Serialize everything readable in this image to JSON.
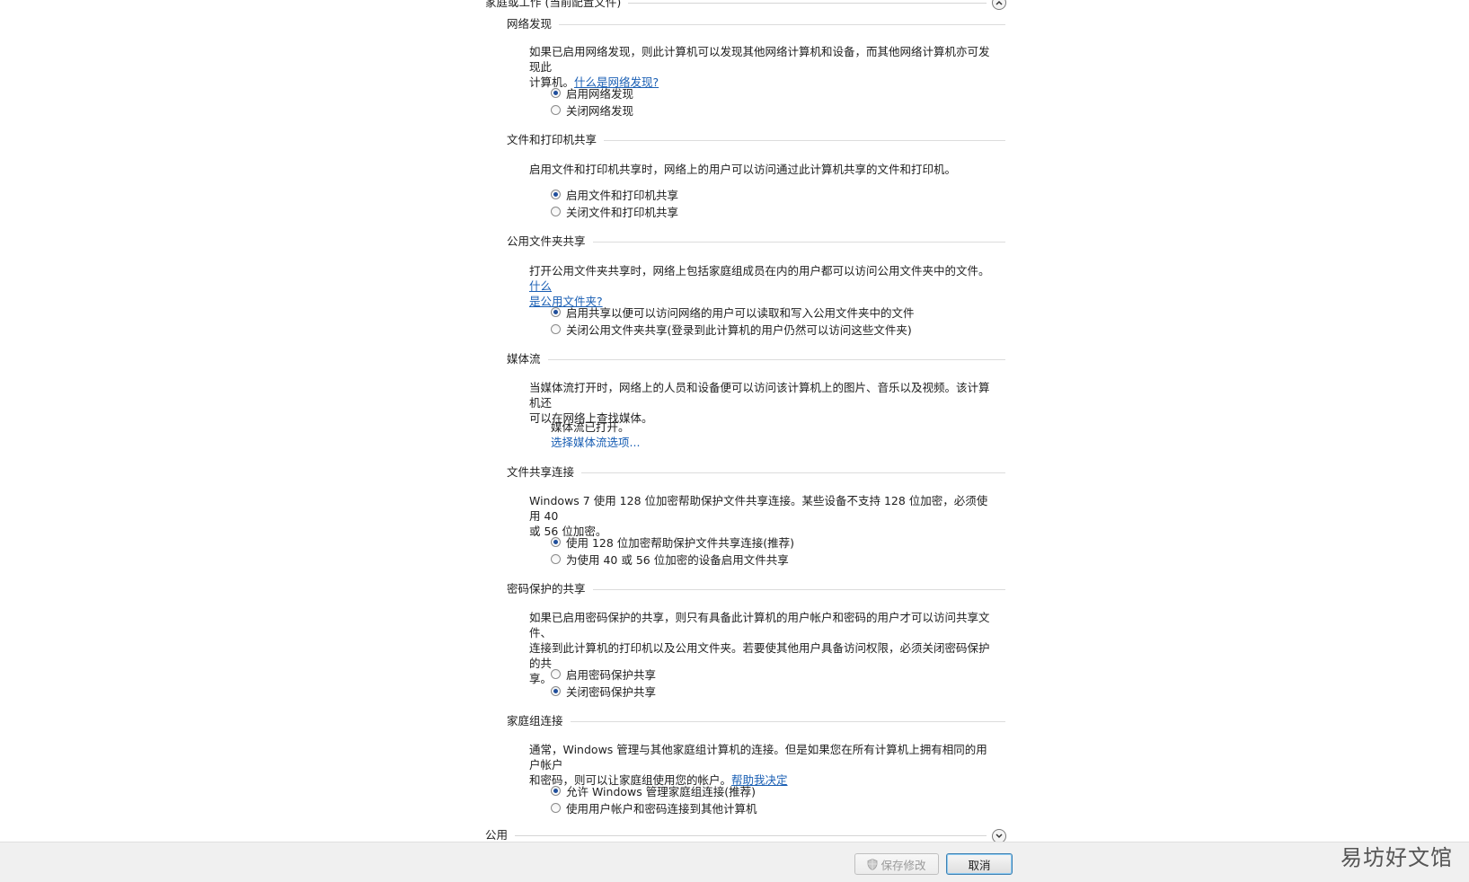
{
  "home_group": {
    "title": "家庭或工作 (当前配置文件)"
  },
  "public_group": {
    "title": "公用"
  },
  "sections": {
    "discovery": {
      "title": "网络发现",
      "desc_line1": "如果已启用网络发现，则此计算机可以发现其他网络计算机和设备，而其他网络计算机亦可发现此",
      "desc_line2": "计算机。",
      "link": "什么是网络发现?",
      "options": [
        "启用网络发现",
        "关闭网络发现"
      ],
      "selected": 0
    },
    "file_print": {
      "title": "文件和打印机共享",
      "desc": "启用文件和打印机共享时，网络上的用户可以访问通过此计算机共享的文件和打印机。",
      "options": [
        "启用文件和打印机共享",
        "关闭文件和打印机共享"
      ],
      "selected": 0
    },
    "public_folder": {
      "title": "公用文件夹共享",
      "desc_line1": "打开公用文件夹共享时，网络上包括家庭组成员在内的用户都可以访问公用文件夹中的文件。",
      "link_line1": "什么",
      "link_line2": "是公用文件夹?",
      "options": [
        "启用共享以便可以访问网络的用户可以读取和写入公用文件夹中的文件",
        "关闭公用文件夹共享(登录到此计算机的用户仍然可以访问这些文件夹)"
      ],
      "selected": 0
    },
    "media": {
      "title": "媒体流",
      "desc_line1": "当媒体流打开时，网络上的人员和设备便可以访问该计算机上的图片、音乐以及视频。该计算机还",
      "desc_line2": "可以在网络上查找媒体。",
      "status": "媒体流已打开。",
      "link": "选择媒体流选项..."
    },
    "file_sharing_conn": {
      "title": "文件共享连接",
      "desc_line1": "Windows 7 使用 128 位加密帮助保护文件共享连接。某些设备不支持 128 位加密，必须使用 40",
      "desc_line2": "或 56 位加密。",
      "options": [
        "使用 128 位加密帮助保护文件共享连接(推荐)",
        "为使用 40 或 56 位加密的设备启用文件共享"
      ],
      "selected": 0
    },
    "password": {
      "title": "密码保护的共享",
      "desc_line1": "如果已启用密码保护的共享，则只有具备此计算机的用户帐户和密码的用户才可以访问共享文件、",
      "desc_line2": "连接到此计算机的打印机以及公用文件夹。若要使其他用户具备访问权限，必须关闭密码保护的共",
      "desc_line3": "享。",
      "options": [
        "启用密码保护共享",
        "关闭密码保护共享"
      ],
      "selected": 1
    },
    "homegroup": {
      "title": "家庭组连接",
      "desc_line1": "通常，Windows 管理与其他家庭组计算机的连接。但是如果您在所有计算机上拥有相同的用户帐户",
      "desc_line2": "和密码，则可以让家庭组使用您的帐户。",
      "link": "帮助我决定",
      "options": [
        "允许 Windows 管理家庭组连接(推荐)",
        "使用用户帐户和密码连接到其他计算机"
      ],
      "selected": 0
    }
  },
  "footer": {
    "save_label": "保存修改",
    "cancel_label": "取消"
  },
  "watermark": "易坊好文馆",
  "icons": {
    "collapse": "chevron-up-icon",
    "expand": "chevron-down-icon",
    "shield": "uac-shield-icon"
  },
  "colors": {
    "link": "#1a5fb4",
    "radio_dot": "#1f4e9c"
  }
}
